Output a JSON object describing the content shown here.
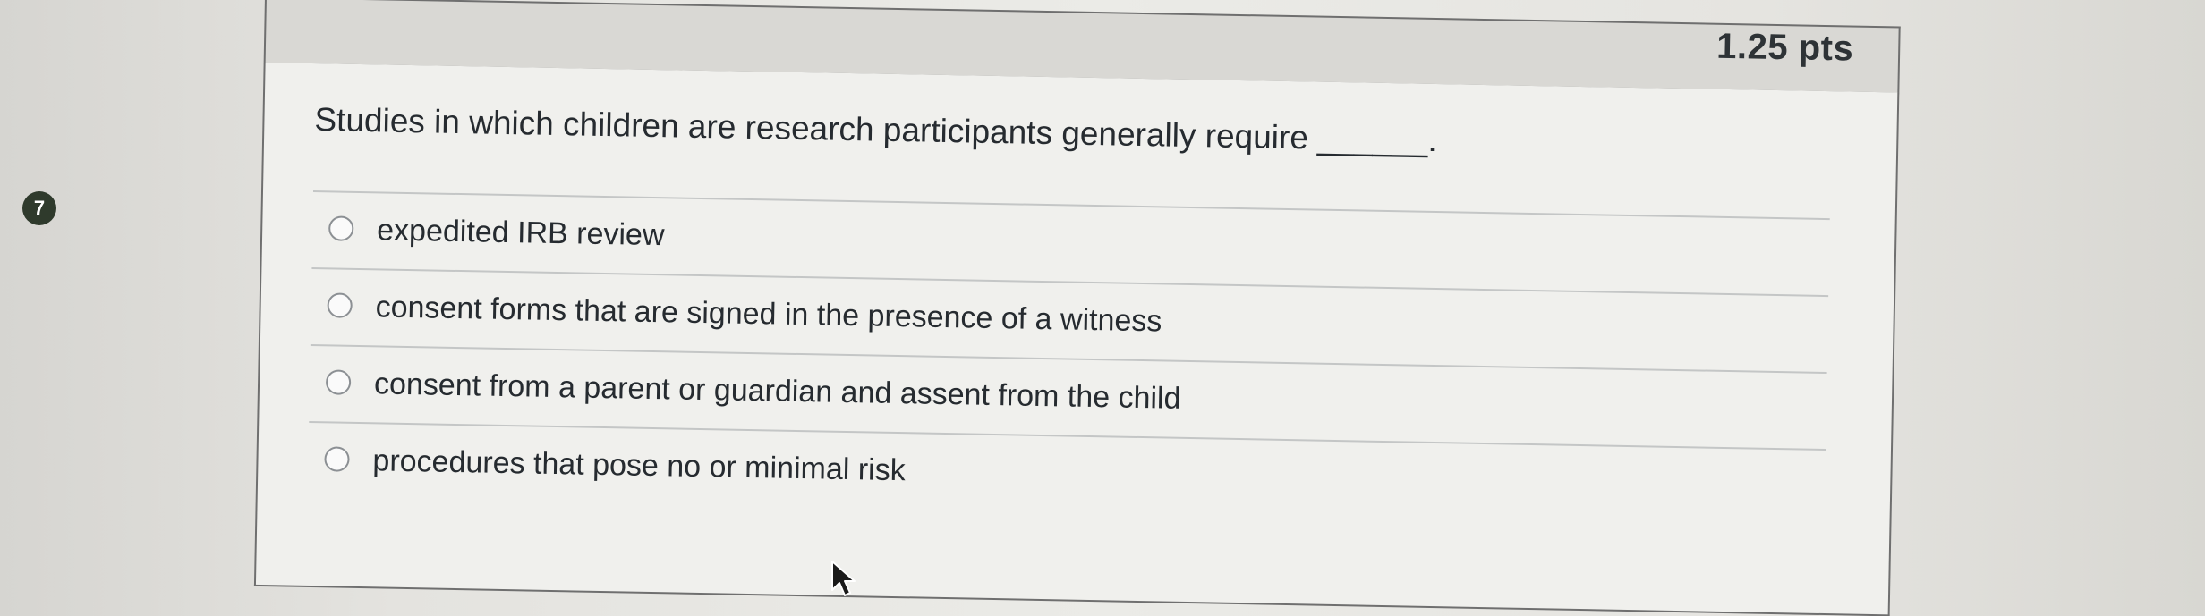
{
  "question": {
    "number": "7",
    "points": "1.25 pts",
    "text": "Studies in which children are research participants generally require ______."
  },
  "answers": [
    {
      "label": "expedited IRB review"
    },
    {
      "label": "consent forms that are signed in the presence of a witness"
    },
    {
      "label": "consent from a parent or guardian and assent from the child"
    },
    {
      "label": "procedures that pose no or minimal risk"
    }
  ],
  "icons": {
    "question_number_badge": "circle-badge",
    "answer_option": "radio-button",
    "pointer": "arrow-cursor-icon"
  },
  "colors": {
    "badge": "#2f3a2c",
    "card_header": "#d9d8d4",
    "card_body": "#f0f0ed",
    "text": "#262b30"
  }
}
